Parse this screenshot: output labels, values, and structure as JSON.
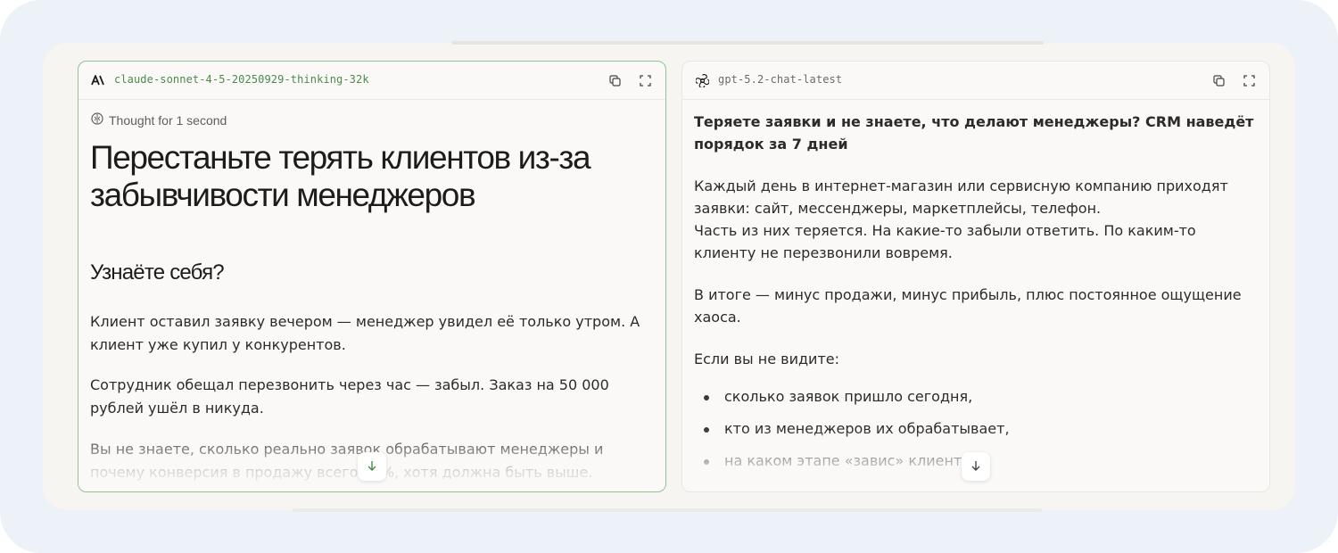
{
  "left_panel": {
    "model_name": "claude-sonnet-4-5-20250929-thinking-32k",
    "thought": "Thought for 1 second",
    "heading": "Перестаньте терять клиентов из-за забывчивости менеджеров",
    "subheading": "Узнаёте себя?",
    "paragraphs": [
      "Клиент оставил заявку вечером — менеджер увидел её только утром. А клиент уже купил у конкурентов.",
      "Сотрудник обещал перезвонить через час — забыл. Заказ на 50 000 рублей ушёл в никуда.",
      "Вы не знаете, сколько реально заявок обрабатывают менеджеры и почему конверсия в продажу всего 10%, хотя должна быть выше."
    ],
    "icons": {
      "logo": "anthropic-logo-icon",
      "thought": "brain-icon",
      "copy": "copy-icon",
      "expand": "expand-icon",
      "scroll": "arrow-down-icon"
    },
    "border_color": "#8ec58c"
  },
  "right_panel": {
    "model_name": "gpt-5.2-chat-latest",
    "heading": "Теряете заявки и не знаете, что делают менеджеры? CRM наведёт порядок за 7 дней",
    "paragraph1_line1": "Каждый день в интернет-магазин или сервисную компанию приходят заявки: сайт, мессенджеры, маркетплейсы, телефон.",
    "paragraph1_line2": "Часть из них теряется. На какие-то забыли ответить. По каким-то клиенту не перезвонили вовремя.",
    "paragraph2": "В итоге — минус продажи, минус прибыль, плюс постоянное ощущение хаоса.",
    "paragraph3": "Если вы не видите:",
    "bullets": [
      "сколько заявок пришло сегодня,",
      "кто из менеджеров их обрабатывает,",
      "на каком этапе «завис» клиент,"
    ],
    "icons": {
      "logo": "openai-logo-icon",
      "copy": "copy-icon",
      "expand": "expand-icon",
      "scroll": "arrow-down-icon"
    }
  }
}
